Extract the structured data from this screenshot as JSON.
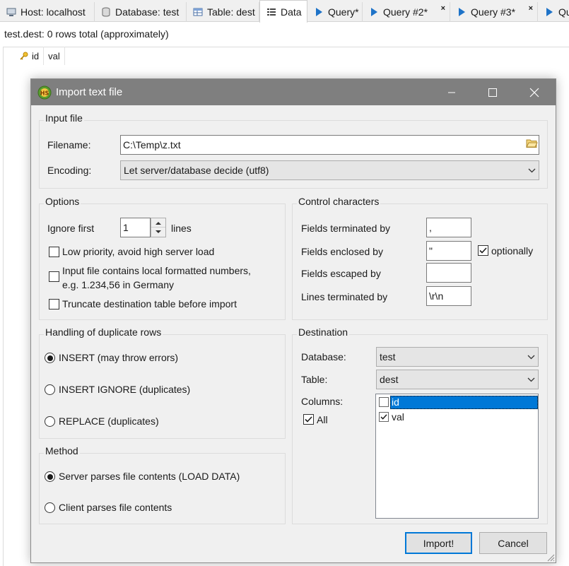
{
  "tabs": [
    {
      "label": "Host: localhost",
      "icon": "host-icon"
    },
    {
      "label": "Database: test",
      "icon": "database-icon"
    },
    {
      "label": "Table: dest",
      "icon": "table-icon"
    },
    {
      "label": "Data",
      "icon": "data-icon"
    },
    {
      "label": "Query*",
      "icon": "query-play-icon"
    },
    {
      "label": "Query #2*",
      "icon": "query-play-icon",
      "close": "×"
    },
    {
      "label": "Query #3*",
      "icon": "query-play-icon",
      "close": "×"
    },
    {
      "label": "Qu",
      "icon": "query-play-icon"
    }
  ],
  "grid": {
    "status": "test.dest: 0 rows total (approximately)",
    "columns": [
      "id",
      "val"
    ]
  },
  "dialog": {
    "title": "Import text file",
    "input_file": {
      "group_title": "Input file",
      "filename_label": "Filename:",
      "filename_value": "C:\\Temp\\z.txt",
      "encoding_label": "Encoding:",
      "encoding_value": "Let server/database decide (utf8)"
    },
    "options": {
      "group_title": "Options",
      "ignore_first_label": "Ignore first",
      "ignore_first_value": "1",
      "lines_label": "lines",
      "low_priority_label": "Low priority, avoid high server load",
      "low_priority_checked": false,
      "local_numbers_label_1": "Input file contains local formatted numbers,",
      "local_numbers_label_2": "e.g. 1.234,56 in Germany",
      "local_numbers_checked": false,
      "truncate_label": "Truncate destination table before import",
      "truncate_checked": false
    },
    "control_chars": {
      "group_title": "Control characters",
      "fields_terminated_label": "Fields terminated by",
      "fields_terminated_value": ",",
      "fields_enclosed_label": "Fields enclosed by",
      "fields_enclosed_value": "\"",
      "optionally_label": "optionally",
      "optionally_checked": true,
      "fields_escaped_label": "Fields escaped by",
      "fields_escaped_value": "",
      "lines_terminated_label": "Lines terminated by",
      "lines_terminated_value": "\\r\\n"
    },
    "duplicates": {
      "group_title": "Handling of duplicate rows",
      "options": [
        "INSERT (may throw errors)",
        "INSERT IGNORE (duplicates)",
        "REPLACE (duplicates)"
      ],
      "selected_index": 0
    },
    "method": {
      "group_title": "Method",
      "options": [
        "Server parses file contents (LOAD DATA)",
        "Client parses file contents"
      ],
      "selected_index": 0
    },
    "destination": {
      "group_title": "Destination",
      "database_label": "Database:",
      "database_value": "test",
      "table_label": "Table:",
      "table_value": "dest",
      "columns_label": "Columns:",
      "all_label": "All",
      "all_checked": true,
      "columns": [
        {
          "name": "id",
          "checked": false,
          "selected": true
        },
        {
          "name": "val",
          "checked": true,
          "selected": false
        }
      ]
    },
    "buttons": {
      "import_label": "Import!",
      "cancel_label": "Cancel"
    }
  },
  "colors": {
    "accent": "#0078d7",
    "titlebar": "#7f7f7f",
    "dialog_bg": "#f0f0f0",
    "query_icon": "#1e73c8"
  }
}
